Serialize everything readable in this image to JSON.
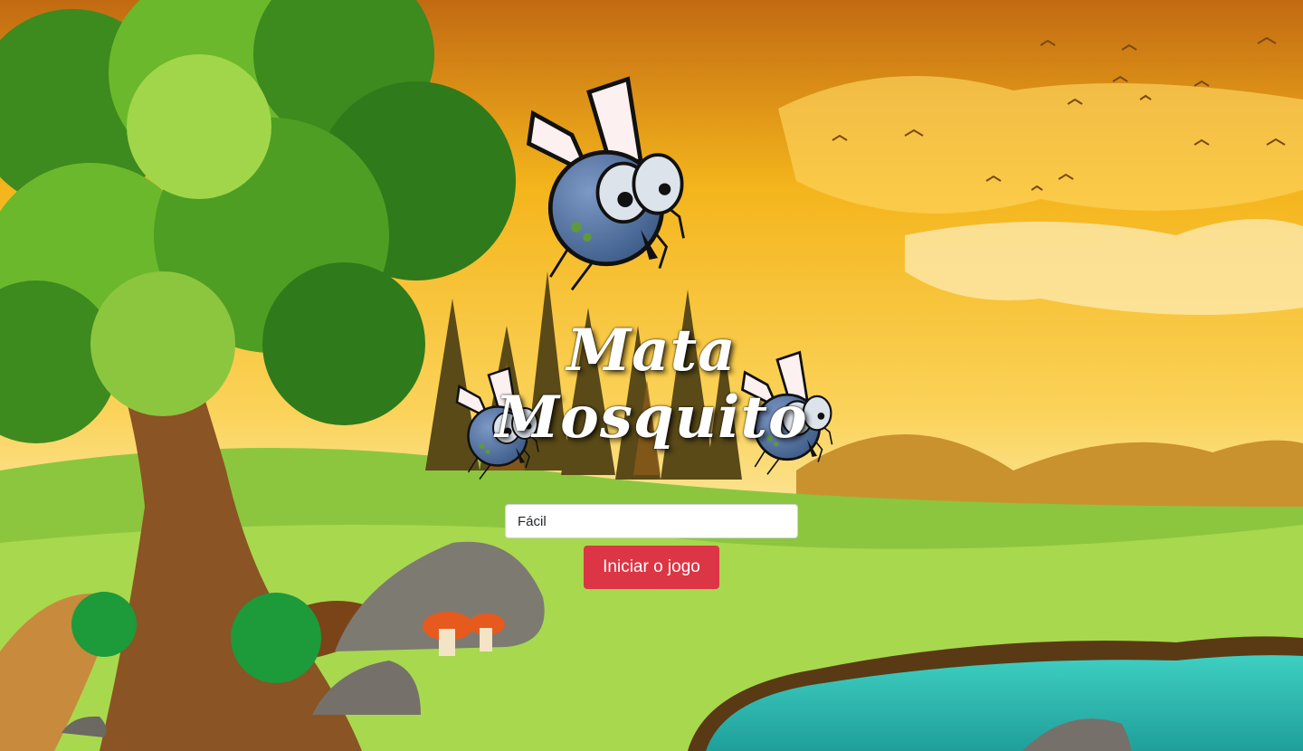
{
  "game": {
    "title_line1": "Mata",
    "title_line2": "Mosquito",
    "difficulty_selected": "Fácil",
    "start_button_label": "Iniciar o jogo"
  },
  "colors": {
    "sky_top": "#c26a12",
    "sky_mid": "#f4b51c",
    "sky_low": "#fbe7a0",
    "grass": "#8cc63f",
    "water": "#2fbfb4",
    "button": "#dc3545",
    "mosquito_body": "#4f6f9e"
  }
}
